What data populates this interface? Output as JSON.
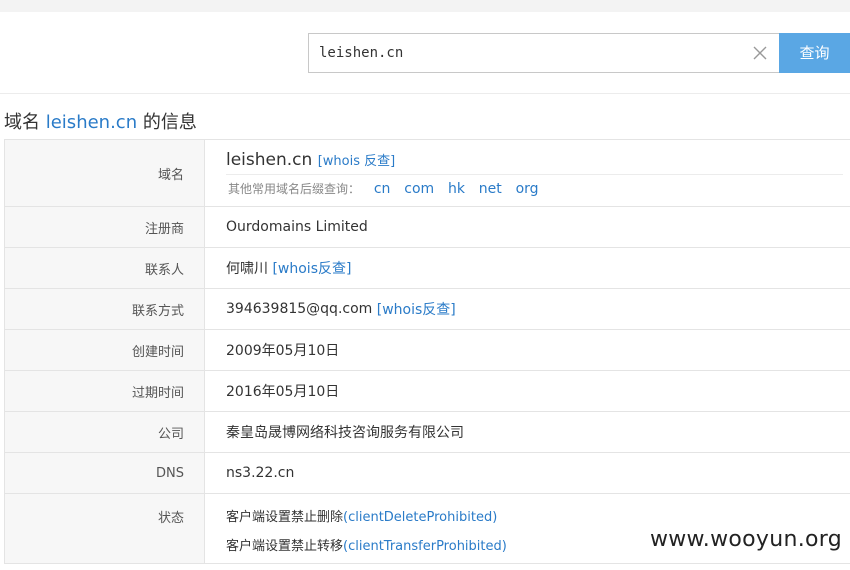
{
  "search": {
    "value": "leishen.cn",
    "button_label": "查询"
  },
  "title": {
    "prefix": "域名 ",
    "domain": "leishen.cn",
    "suffix": " 的信息"
  },
  "rows": {
    "domain": {
      "label": "域名",
      "value": "leishen.cn",
      "whois_link": "[whois 反查]",
      "suffix_prompt": "其他常用域名后缀查询：",
      "suffixes": [
        "cn",
        "com",
        "hk",
        "net",
        "org"
      ]
    },
    "registrar": {
      "label": "注册商",
      "value": "Ourdomains Limited"
    },
    "contact": {
      "label": "联系人",
      "value": "何啸川",
      "link": "[whois反查]"
    },
    "contact_method": {
      "label": "联系方式",
      "value": "394639815@qq.com",
      "link": "[whois反查]"
    },
    "created": {
      "label": "创建时间",
      "value": "2009年05月10日"
    },
    "expires": {
      "label": "过期时间",
      "value": "2016年05月10日"
    },
    "company": {
      "label": "公司",
      "value": "秦皇岛晟博网络科技咨询服务有限公司"
    },
    "dns": {
      "label": "DNS",
      "value": "ns3.22.cn"
    },
    "status": {
      "label": "状态",
      "lines": [
        {
          "text": "客户端设置禁止删除",
          "code": "(clientDeleteProhibited)"
        },
        {
          "text": "客户端设置禁止转移",
          "code": "(clientTransferProhibited)"
        }
      ]
    }
  },
  "watermark": "www.wooyun.org"
}
